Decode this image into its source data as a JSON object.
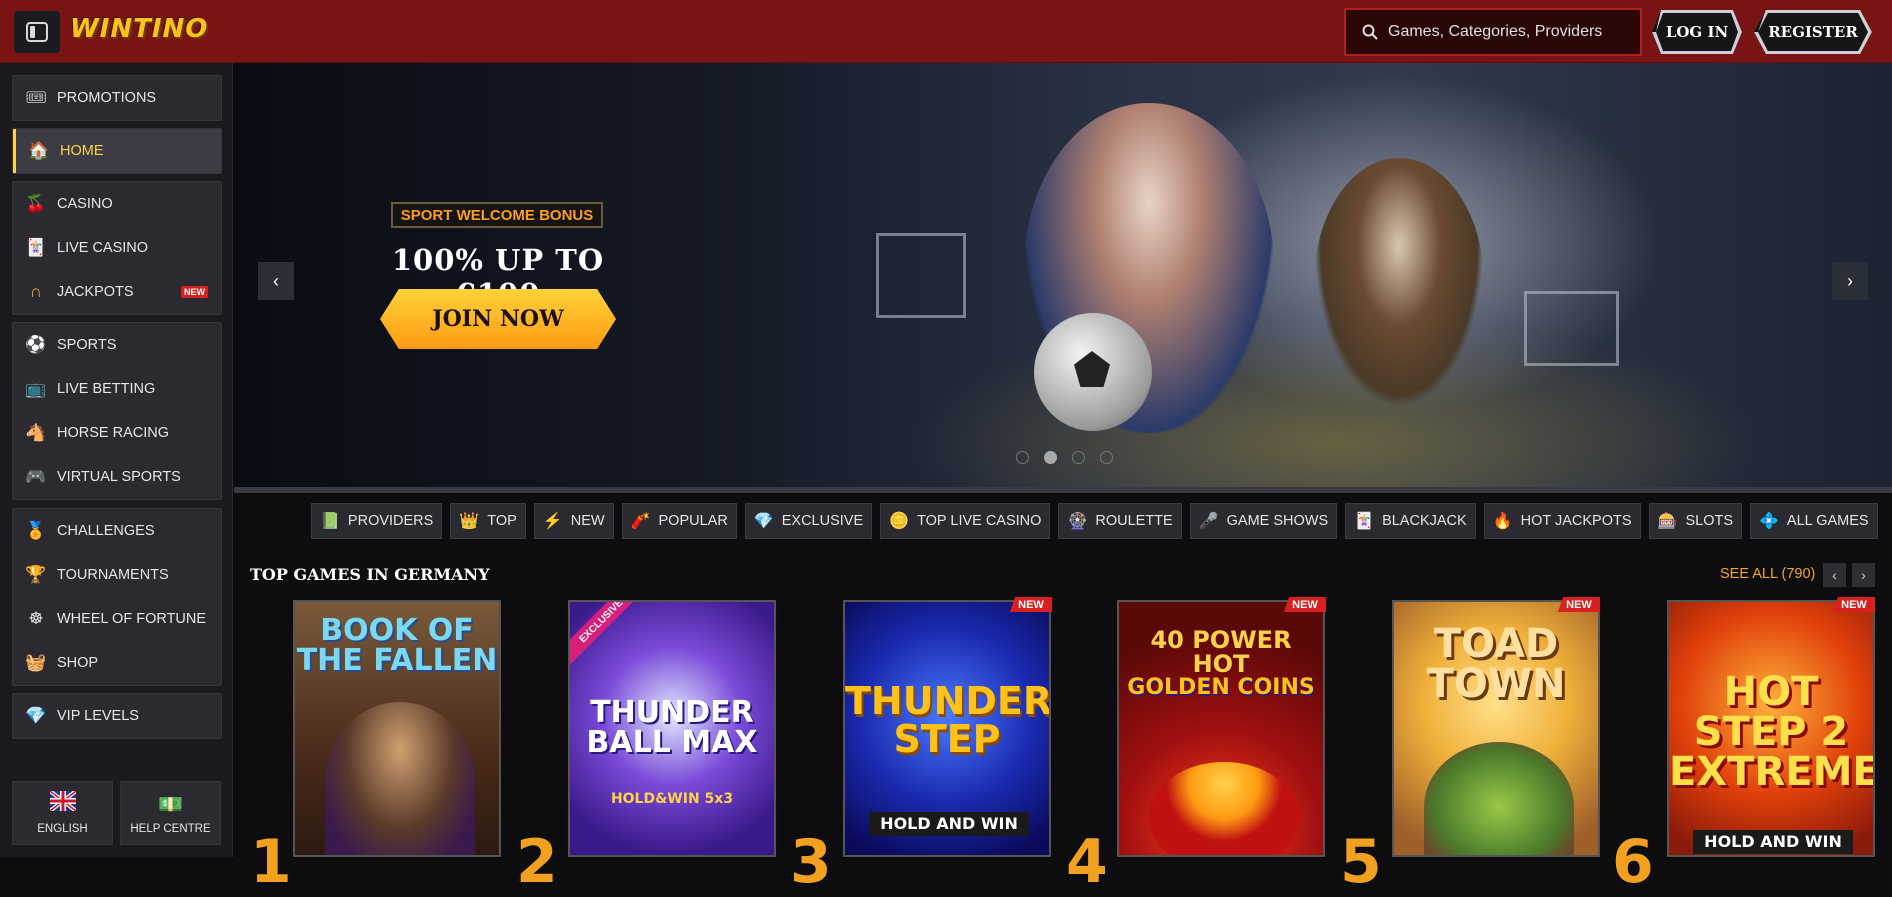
{
  "header": {
    "logo": "WINTINO",
    "search_placeholder": "Games, Categories, Providers",
    "login_label": "LOG IN",
    "register_label": "REGISTER",
    "bg_color": "#7a1414"
  },
  "sidebar": {
    "groups": [
      [
        {
          "label": "PROMOTIONS",
          "icon": "promotions-icon"
        }
      ],
      [
        {
          "label": "HOME",
          "icon": "home-icon",
          "active": true
        }
      ],
      [
        {
          "label": "CASINO",
          "icon": "cherries-icon"
        },
        {
          "label": "LIVE CASINO",
          "icon": "cards-icon"
        },
        {
          "label": "JACKPOTS",
          "icon": "horseshoe-icon",
          "badge": "NEW"
        }
      ],
      [
        {
          "label": "SPORTS",
          "icon": "football-icon"
        },
        {
          "label": "LIVE BETTING",
          "icon": "live-tv-icon"
        },
        {
          "label": "HORSE RACING",
          "icon": "horse-icon"
        },
        {
          "label": "VIRTUAL SPORTS",
          "icon": "gamepad-icon"
        }
      ],
      [
        {
          "label": "CHALLENGES",
          "icon": "medal-icon"
        },
        {
          "label": "TOURNAMENTS",
          "icon": "trophy-icon"
        },
        {
          "label": "WHEEL OF FORTUNE",
          "icon": "wheel-icon"
        },
        {
          "label": "SHOP",
          "icon": "basket-icon"
        }
      ],
      [
        {
          "label": "VIP LEVELS",
          "icon": "diamond-icon"
        }
      ]
    ],
    "footer": [
      {
        "label": "ENGLISH",
        "icon": "uk-flag-icon"
      },
      {
        "label": "HELP CENTRE",
        "icon": "help-icon"
      }
    ],
    "accent": "#ffd24a"
  },
  "hero": {
    "badge": "SPORT WELCOME BONUS",
    "title": "100% UP TO €100",
    "cta": "JOIN NOW",
    "slides": 4,
    "active_slide": 2
  },
  "chips": [
    {
      "label": "PROVIDERS",
      "icon": "book-icon"
    },
    {
      "label": "TOP",
      "icon": "crown-icon"
    },
    {
      "label": "NEW",
      "icon": "lightning-icon"
    },
    {
      "label": "POPULAR",
      "icon": "flame-icon"
    },
    {
      "label": "EXCLUSIVE",
      "icon": "diamond-icon"
    },
    {
      "label": "TOP LIVE CASINO",
      "icon": "chip-icon"
    },
    {
      "label": "ROULETTE",
      "icon": "roulette-icon"
    },
    {
      "label": "GAME SHOWS",
      "icon": "microphone-icon"
    },
    {
      "label": "BLACKJACK",
      "icon": "cards-icon"
    },
    {
      "label": "HOT JACKPOTS",
      "icon": "fire-icon"
    },
    {
      "label": "SLOTS",
      "icon": "slots-icon"
    },
    {
      "label": "ALL GAMES",
      "icon": "gems-icon"
    }
  ],
  "top_games": {
    "title": "TOP GAMES IN GERMANY",
    "see_all": "SEE ALL (790)",
    "games": [
      {
        "rank": "1",
        "title": "BOOK OF THE FALLEN",
        "new": false,
        "exclusive": false
      },
      {
        "rank": "2",
        "title": "THUNDER BALL MAX",
        "subtitle": "HOLD&WIN 5x3",
        "new": false,
        "exclusive": true
      },
      {
        "rank": "3",
        "title": "THUNDER STEP",
        "subtitle": "HOLD AND WIN",
        "new": true,
        "exclusive": false
      },
      {
        "rank": "4",
        "title": "40 POWER HOT",
        "subtitle": "GOLDEN COINS",
        "new": true,
        "exclusive": false
      },
      {
        "rank": "5",
        "title": "TOAD TOWN",
        "new": true,
        "exclusive": false
      },
      {
        "rank": "6",
        "title": "HOT STEP 2 EXTREME",
        "subtitle": "HOLD AND WIN",
        "new": true,
        "exclusive": false
      }
    ],
    "new_label": "NEW",
    "exclusive_label": "EXCLUSIVE",
    "see_all_color": "#f5a623"
  }
}
